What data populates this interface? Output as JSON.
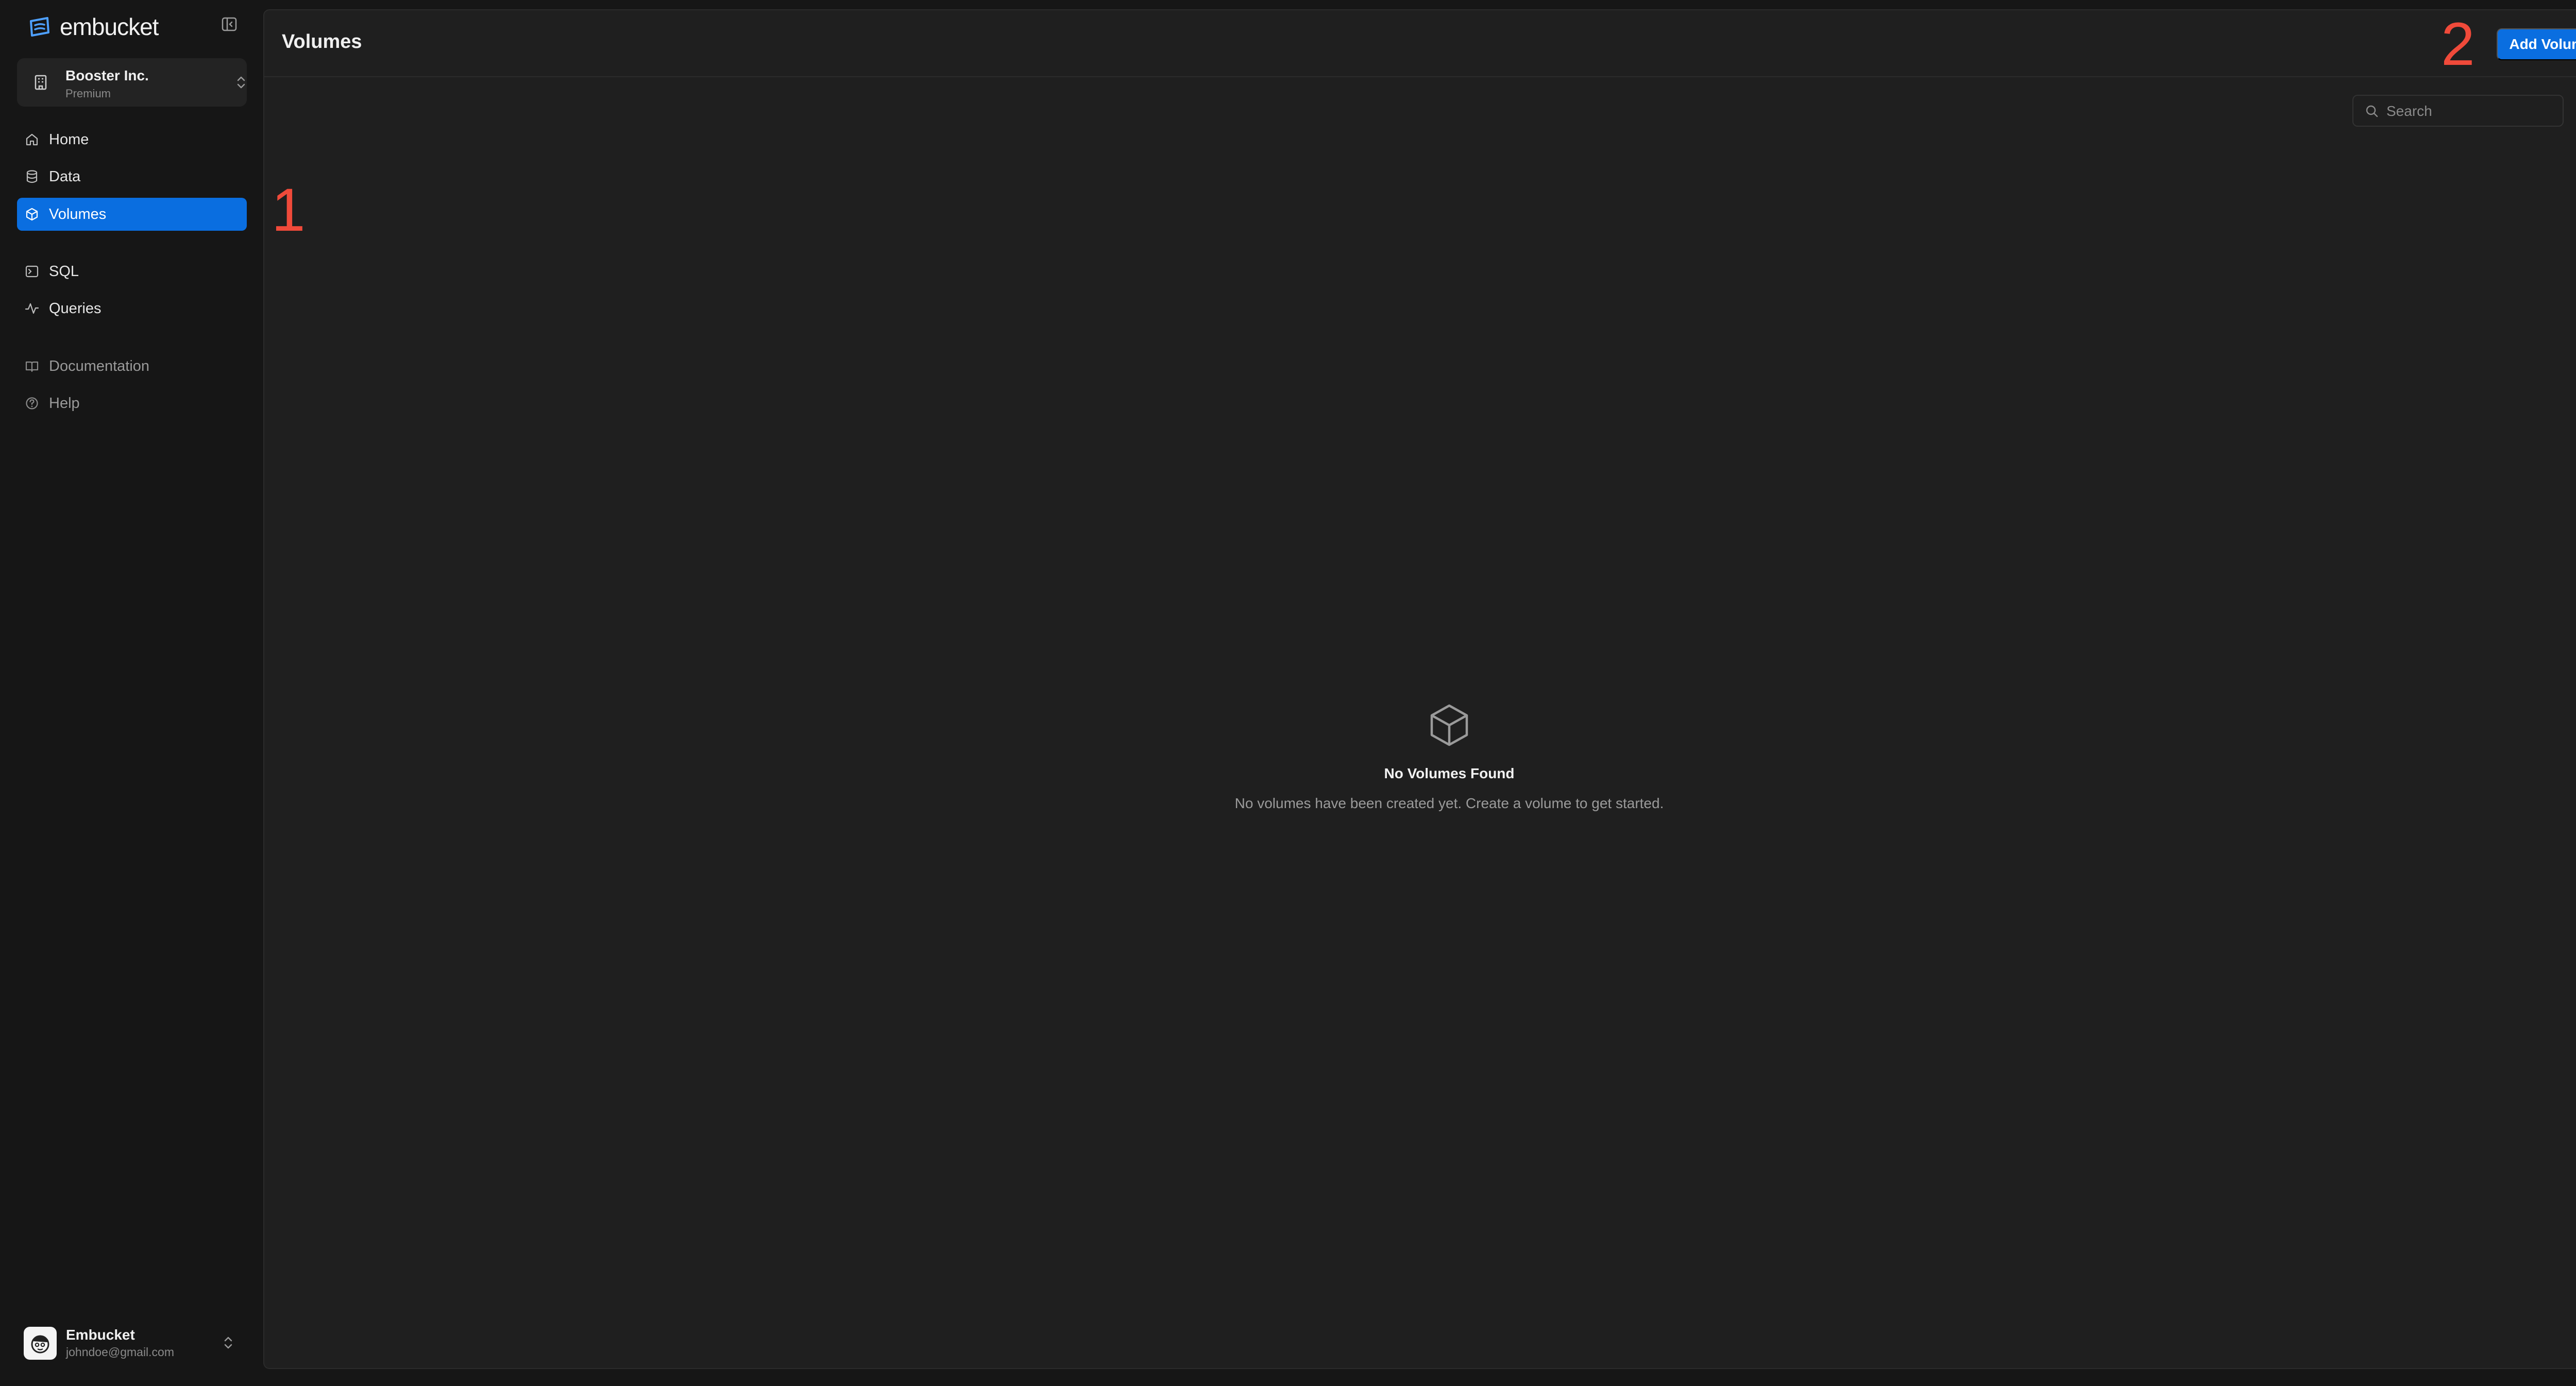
{
  "app": {
    "name": "embucket"
  },
  "org": {
    "name": "Booster Inc.",
    "plan": "Premium"
  },
  "nav": {
    "primary": [
      {
        "id": "home",
        "label": "Home",
        "icon": "home-icon"
      },
      {
        "id": "data",
        "label": "Data",
        "icon": "database-icon"
      },
      {
        "id": "volumes",
        "label": "Volumes",
        "icon": "box-icon",
        "active": true
      }
    ],
    "tools": [
      {
        "id": "sql",
        "label": "SQL",
        "icon": "terminal-icon"
      },
      {
        "id": "queries",
        "label": "Queries",
        "icon": "activity-icon"
      }
    ],
    "support": [
      {
        "id": "documentation",
        "label": "Documentation",
        "icon": "book-icon"
      },
      {
        "id": "help",
        "label": "Help",
        "icon": "help-circle-icon"
      }
    ]
  },
  "user": {
    "name": "Embucket",
    "email": "johndoe@gmail.com"
  },
  "page": {
    "title": "Volumes",
    "add_button": "Add Volume"
  },
  "search": {
    "placeholder": "Search",
    "value": ""
  },
  "empty_state": {
    "title": "No Volumes Found",
    "description": "No volumes have been created yet. Create a volume to get started."
  },
  "annotations": [
    "1",
    "2"
  ],
  "colors": {
    "accent": "#0a6ee0",
    "background": "#161616",
    "panel": "#1f1f1f",
    "annotation": "#f04a3a"
  }
}
